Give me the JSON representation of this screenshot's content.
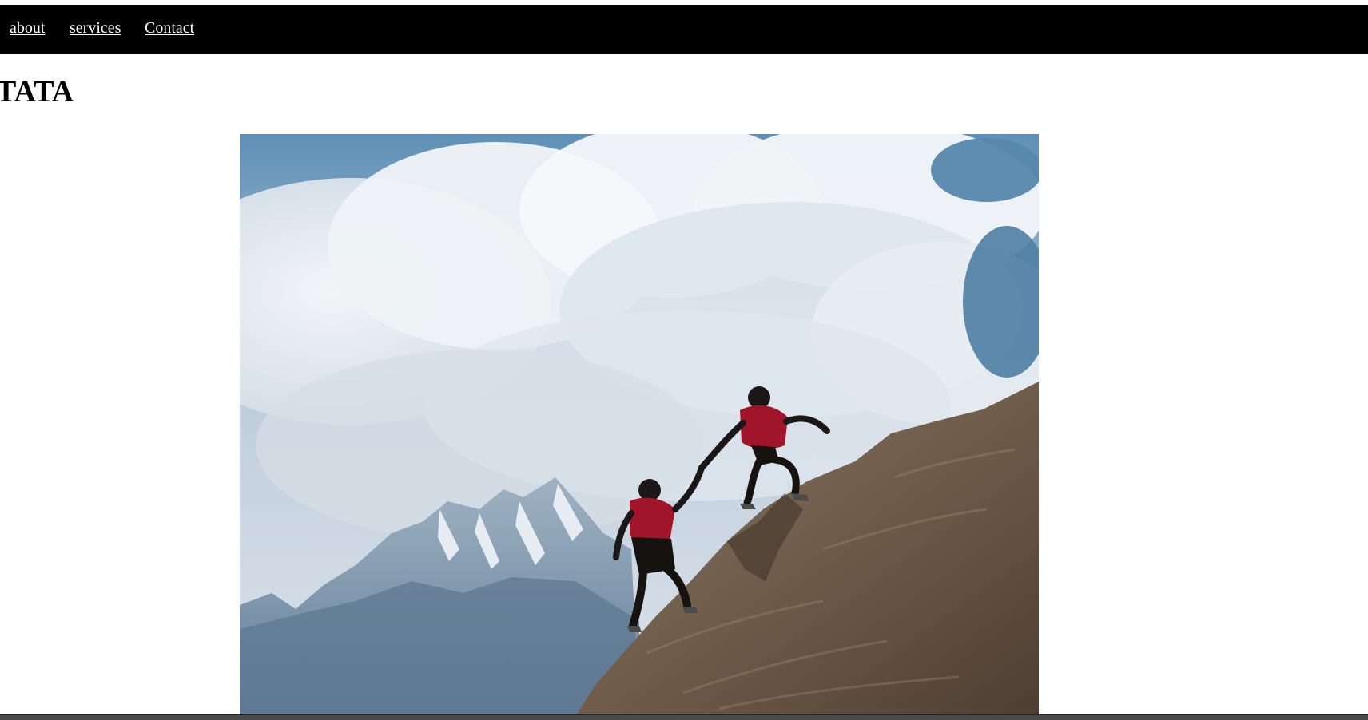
{
  "nav": {
    "links": [
      {
        "label": "about"
      },
      {
        "label": "services"
      },
      {
        "label": "Contact"
      }
    ]
  },
  "page": {
    "title": "TATA"
  },
  "hero_image": {
    "subject": "two climbers helping each other up a rocky slope with mountains behind",
    "sky_color": "#4f84aa",
    "cloud_color": "#e8edf2",
    "rock_color": "#7a6652",
    "shirt_color": "#a0152a",
    "mountain_color": "#7f97ae"
  }
}
